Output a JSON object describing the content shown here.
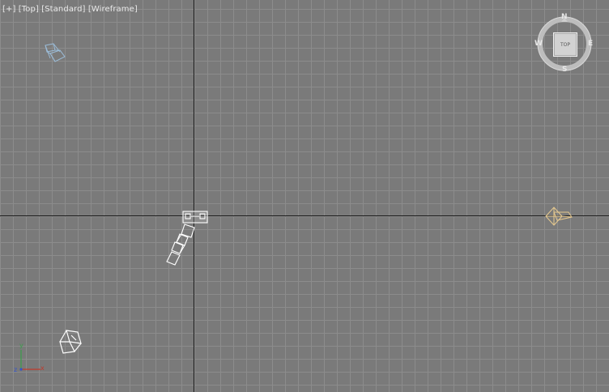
{
  "viewport": {
    "label_plus": "[+]",
    "label_view": "[Top]",
    "label_shading": "[Standard]",
    "label_mode": "[Wireframe]"
  },
  "viewcube": {
    "face_label": "TOP",
    "north": "N",
    "south": "S",
    "east": "E",
    "west": "W"
  },
  "axis_gizmo": {
    "x_label": "x",
    "y_label": "y",
    "z_label": "z"
  },
  "colors": {
    "background": "#7a7a7a",
    "grid": "#8c8c8c",
    "world_axis": "#1a1a1a",
    "light_blue_object": "#9bbcd8",
    "camera_object": "#e6c98f",
    "white_object": "#ffffff",
    "gizmo_x": "#c0392b",
    "gizmo_y": "#3aa04a",
    "gizmo_z": "#3555c8"
  }
}
